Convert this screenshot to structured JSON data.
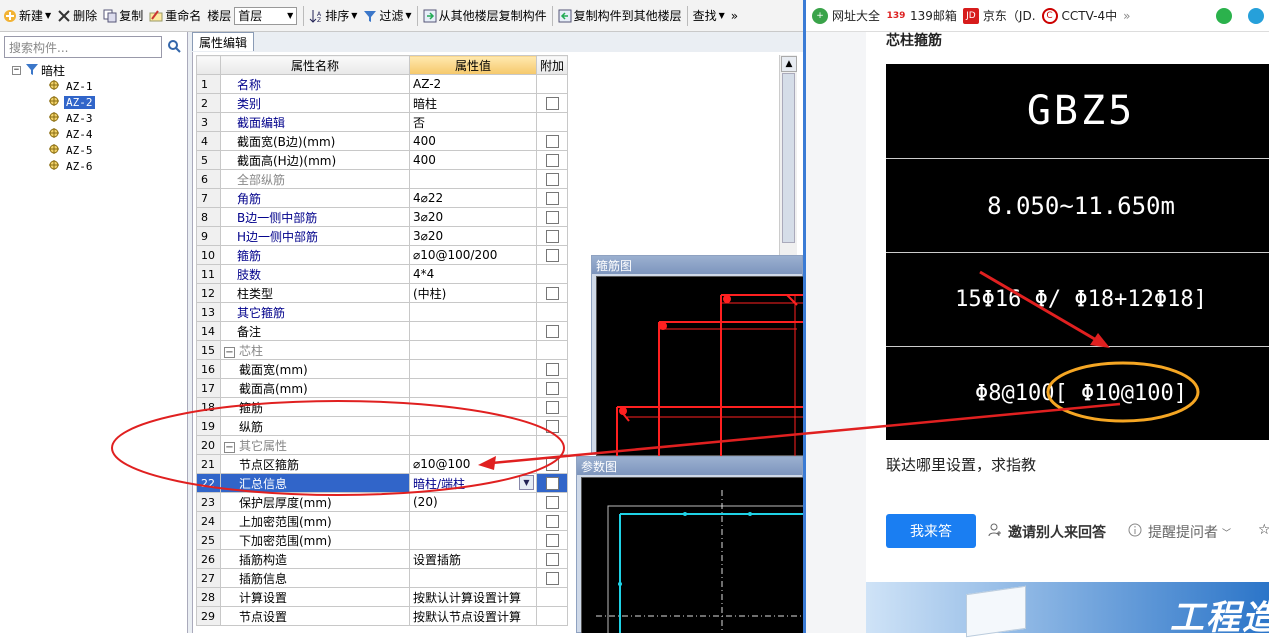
{
  "toolbar": {
    "new_label": "新建",
    "delete_label": "删除",
    "copy_label": "复制",
    "rename_label": "重命名",
    "floor_label": "楼层",
    "floor_value": "首层",
    "sort_label": "排序",
    "filter_label": "过滤",
    "copy_from_label": "从其他楼层复制构件",
    "copy_to_label": "复制构件到其他楼层",
    "find_label": "查找",
    "more": "»"
  },
  "sidebar": {
    "search_placeholder": "搜索构件...",
    "root": "暗柱",
    "items": [
      "AZ-1",
      "AZ-2",
      "AZ-3",
      "AZ-4",
      "AZ-5",
      "AZ-6"
    ],
    "selected_index": 1
  },
  "tab": {
    "label": "属性编辑"
  },
  "grid": {
    "headers": [
      "属性名称",
      "属性值",
      "附加"
    ],
    "rows": [
      {
        "no": "1",
        "name": "名称",
        "value": "AZ-2"
      },
      {
        "no": "2",
        "name": "类别",
        "value": "暗柱"
      },
      {
        "no": "3",
        "name": "截面编辑",
        "value": "否"
      },
      {
        "no": "4",
        "name": "截面宽(B边)(mm)",
        "value": "400"
      },
      {
        "no": "5",
        "name": "截面高(H边)(mm)",
        "value": "400"
      },
      {
        "no": "6",
        "name": "全部纵筋",
        "value": ""
      },
      {
        "no": "7",
        "name": "角筋",
        "value": "4⌀22"
      },
      {
        "no": "8",
        "name": "B边一侧中部筋",
        "value": "3⌀20"
      },
      {
        "no": "9",
        "name": "H边一侧中部筋",
        "value": "3⌀20"
      },
      {
        "no": "10",
        "name": "箍筋",
        "value": "⌀10@100/200"
      },
      {
        "no": "11",
        "name": "肢数",
        "value": "4*4"
      },
      {
        "no": "12",
        "name": "柱类型",
        "value": "(中柱)"
      },
      {
        "no": "13",
        "name": "其它箍筋",
        "value": ""
      },
      {
        "no": "14",
        "name": "备注",
        "value": ""
      },
      {
        "no": "15",
        "name": "芯柱",
        "value": ""
      },
      {
        "no": "16",
        "name": "截面宽(mm)",
        "value": ""
      },
      {
        "no": "17",
        "name": "截面高(mm)",
        "value": ""
      },
      {
        "no": "18",
        "name": "箍筋",
        "value": ""
      },
      {
        "no": "19",
        "name": "纵筋",
        "value": ""
      },
      {
        "no": "20",
        "name": "其它属性",
        "value": ""
      },
      {
        "no": "21",
        "name": "节点区箍筋",
        "value": "⌀10@100"
      },
      {
        "no": "22",
        "name": "汇总信息",
        "value": "暗柱/端柱"
      },
      {
        "no": "23",
        "name": "保护层厚度(mm)",
        "value": "(20)"
      },
      {
        "no": "24",
        "name": "上加密范围(mm)",
        "value": ""
      },
      {
        "no": "25",
        "name": "下加密范围(mm)",
        "value": ""
      },
      {
        "no": "26",
        "name": "插筋构造",
        "value": "设置插筋"
      },
      {
        "no": "27",
        "name": "插筋信息",
        "value": ""
      },
      {
        "no": "28",
        "name": "计算设置",
        "value": "按默认计算设置计算"
      },
      {
        "no": "29",
        "name": "节点设置",
        "value": "按默认节点设置计算"
      }
    ]
  },
  "windows": {
    "stirrup_title": "箍筋图",
    "param_title": "参数图"
  },
  "browser": {
    "bookmarks": [
      "网址大全",
      "139邮箱",
      "京东（JD.",
      "CCTV-4中"
    ],
    "more": "»",
    "page_title": "芯柱箍筋",
    "cad_lines": [
      "GBZ5",
      "8.050~11.650m",
      "15Φ16 Φ/ Φ18+12Φ18]",
      "Φ8@100[ Φ10@100]"
    ],
    "question": "联达哪里设置，求指教",
    "answer_button": "我来答",
    "invite_label": "邀请别人来回答",
    "remind_label": "提醒提问者",
    "banner_text": "工程造"
  },
  "colors": {
    "selection": "#3165c9",
    "annotation_red": "#e02020",
    "highlight_orange": "#f5a623",
    "accent_blue": "#1a7ef2"
  }
}
